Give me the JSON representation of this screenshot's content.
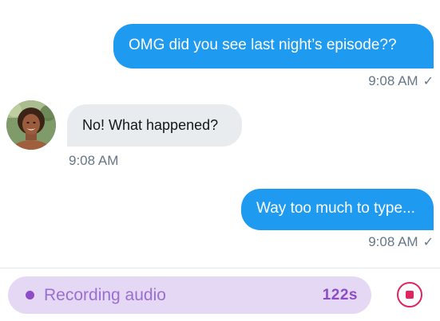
{
  "messages": [
    {
      "direction": "outgoing",
      "text": "OMG did you see last night’s episode??",
      "time": "9:08 AM",
      "status_icon": "check-icon"
    },
    {
      "direction": "incoming",
      "text": "No! What happened?",
      "time": "9:08 AM",
      "avatar": "avatar-photo"
    },
    {
      "direction": "outgoing",
      "text": "Way too much to type...",
      "time": "9:08 AM",
      "status_icon": "check-icon"
    }
  ],
  "recording": {
    "label": "Recording audio",
    "duration": "122s",
    "stop_icon": "stop-icon"
  },
  "colors": {
    "outgoing_bubble": "#1E9BF0",
    "incoming_bubble": "#E9ECEF",
    "timestamp": "#657786",
    "recording_pill": "#E5D8F4",
    "recording_accent": "#8E4CC7",
    "stop_red": "#E0245E"
  },
  "glyphs": {
    "check": "✓"
  }
}
